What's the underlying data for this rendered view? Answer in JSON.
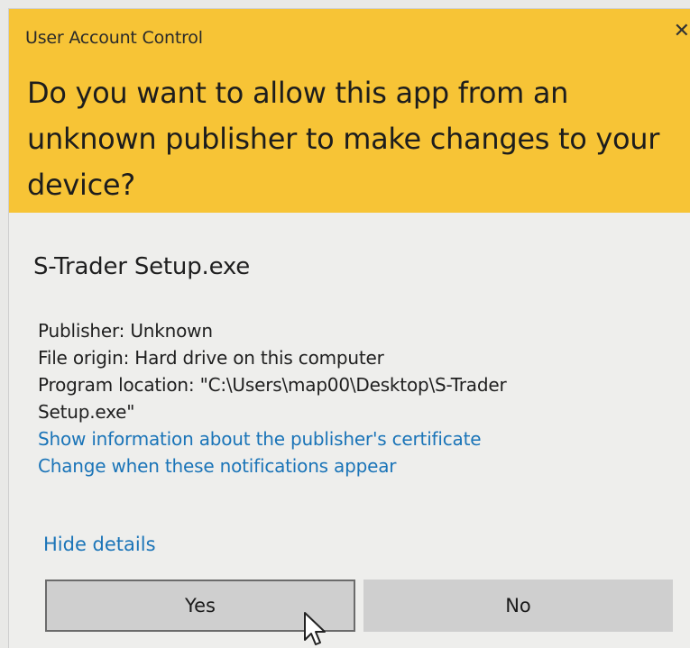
{
  "dialog": {
    "window_title": "User Account Control",
    "close_glyph": "✕",
    "question": "Do you want to allow this app from an unknown publisher to make changes to your device?",
    "app_name": "S-Trader Setup.exe",
    "details": {
      "publisher": "Publisher: Unknown",
      "file_origin": "File origin: Hard drive on this computer",
      "program_location_line1": "Program location: \"C:\\Users\\map00\\Desktop\\S-Trader",
      "program_location_line2": "Setup.exe\""
    },
    "links": {
      "certificate": "Show information about the publisher's certificate",
      "notifications": "Change when these notifications appear",
      "hide_details": "Hide details"
    },
    "buttons": {
      "yes": "Yes",
      "no": "No"
    }
  },
  "colors": {
    "header_bg": "#f7c436",
    "body_bg": "#eeeeec",
    "link": "#1a74b8",
    "button_bg": "#cfcfcf"
  },
  "icons": {
    "close": "close-icon",
    "pointer": "mouse-pointer-icon"
  }
}
